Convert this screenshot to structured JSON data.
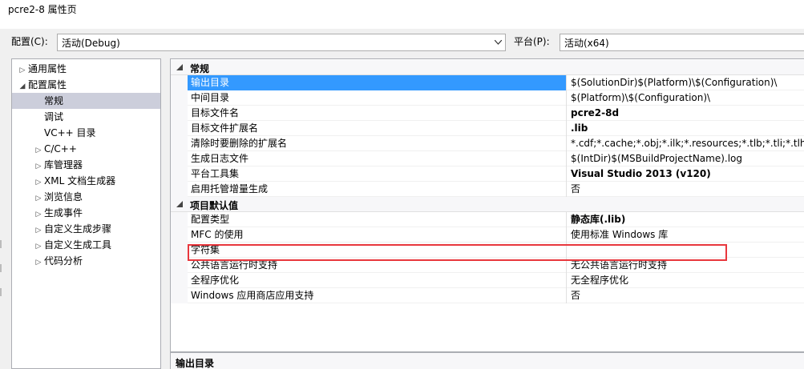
{
  "window": {
    "title": "pcre2-8 属性页"
  },
  "config": {
    "label": "配置(C):",
    "value": "活动(Debug)",
    "platform_label": "平台(P):",
    "platform_value": "活动(x64)"
  },
  "tree": [
    {
      "label": "通用属性",
      "expander": "▷",
      "level": 0
    },
    {
      "label": "配置属性",
      "expander": "◢",
      "level": 0
    },
    {
      "label": "常规",
      "expander": "",
      "level": 1,
      "selected": true
    },
    {
      "label": "调试",
      "expander": "",
      "level": 1
    },
    {
      "label": "VC++ 目录",
      "expander": "",
      "level": 1
    },
    {
      "label": "C/C++",
      "expander": "▷",
      "level": 1
    },
    {
      "label": "库管理器",
      "expander": "▷",
      "level": 1
    },
    {
      "label": "XML 文档生成器",
      "expander": "▷",
      "level": 1
    },
    {
      "label": "浏览信息",
      "expander": "▷",
      "level": 1
    },
    {
      "label": "生成事件",
      "expander": "▷",
      "level": 1
    },
    {
      "label": "自定义生成步骤",
      "expander": "▷",
      "level": 1
    },
    {
      "label": "自定义生成工具",
      "expander": "▷",
      "level": 1
    },
    {
      "label": "代码分析",
      "expander": "▷",
      "level": 1
    }
  ],
  "grid": {
    "general": {
      "title": "常规",
      "rows": [
        {
          "name": "输出目录",
          "value": "$(SolutionDir)$(Platform)\\$(Configuration)\\",
          "selected": true,
          "bold": false
        },
        {
          "name": "中间目录",
          "value": "$(Platform)\\$(Configuration)\\",
          "bold": false
        },
        {
          "name": "目标文件名",
          "value": "pcre2-8d",
          "bold": true
        },
        {
          "name": "目标文件扩展名",
          "value": ".lib",
          "bold": true
        },
        {
          "name": "清除时要删除的扩展名",
          "value": "*.cdf;*.cache;*.obj;*.ilk;*.resources;*.tlb;*.tli;*.tlh;*.tmp",
          "bold": false
        },
        {
          "name": "生成日志文件",
          "value": "$(IntDir)$(MSBuildProjectName).log",
          "bold": false
        },
        {
          "name": "平台工具集",
          "value": "Visual Studio 2013 (v120)",
          "bold": true
        },
        {
          "name": "启用托管增量生成",
          "value": "否",
          "bold": false
        }
      ]
    },
    "defaults": {
      "title": "项目默认值",
      "rows": [
        {
          "name": "配置类型",
          "value": "静态库(.lib)",
          "bold": true
        },
        {
          "name": "MFC 的使用",
          "value": "使用标准 Windows 库",
          "bold": false
        },
        {
          "name": "字符集",
          "value": "",
          "bold": false
        },
        {
          "name": "公共语言运行时支持",
          "value": "无公共语言运行时支持",
          "bold": false
        },
        {
          "name": "全程序优化",
          "value": "无全程序优化",
          "bold": false
        },
        {
          "name": "Windows 应用商店应用支持",
          "value": "否",
          "bold": false
        }
      ]
    }
  },
  "description": {
    "title": "输出目录"
  },
  "colors": {
    "selection": "#3399ff",
    "highlight_box": "#e8373d",
    "tree_selection": "#cccedb"
  }
}
